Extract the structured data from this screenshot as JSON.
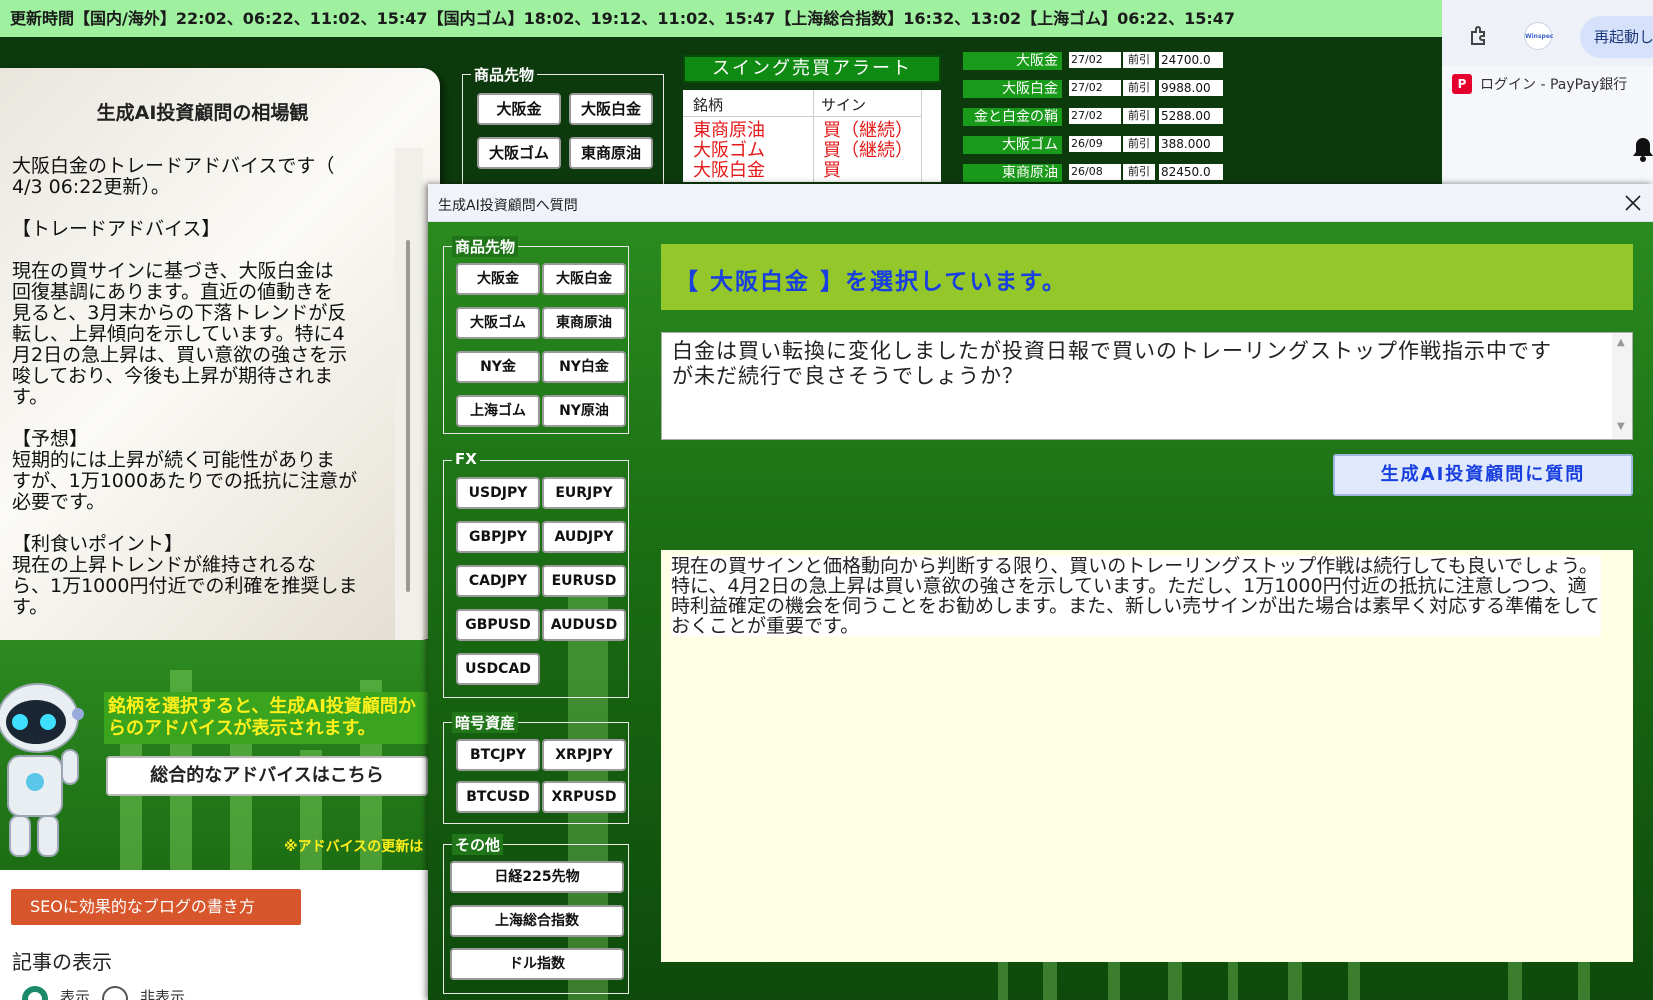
{
  "ticker": "更新時間【国内/海外】22:02、06:22、11:02、15:47【国内ゴム】18:02、19:12、11:02、15:47【上海総合指数】16:32、13:02【上海ゴム】06:22、15:47",
  "browser": {
    "restart_label": "再起動して",
    "ws_badge": "Winspec",
    "bookmark_label": "ログイン - PayPay銀行",
    "bookmark_icon_text": "P"
  },
  "advice": {
    "title": "生成AI投資顧問の相場観",
    "body": "大阪白金のトレードアドバイスです（\n4/3 06:22更新）。\n\n【トレードアドバイス】\n\n現在の買サインに基づき、大阪白金は\n回復基調にあります。直近の値動きを\n見ると、3月末からの下落トレンドが反\n転し、上昇傾向を示しています。特に4\n月2日の急上昇は、買い意欲の強さを示\n唆しており、今後も上昇が期待されま\nす。\n\n【予想】\n短期的には上昇が続く可能性がありま\nすが、1万1000あたりでの抵抗に注意が\n必要です。\n\n【利食いポイント】\n現在の上昇トレンドが維持されるな\nら、1万1000円付近での利確を推奨しま\nす。"
  },
  "left_promo": {
    "note_line1": "銘柄を選択すると、生成AI投資顧問か",
    "note_line2": "らのアドバイスが表示されます。",
    "overall_button": "総合的なアドバイスはこちら",
    "update_note": "※アドバイスの更新は"
  },
  "blog": {
    "seo_button": "SEOに効果的なブログの書き方",
    "article_label": "記事の表示",
    "radio_show": "表示",
    "radio_hide": "非表示"
  },
  "bg_products": {
    "legend": "商品先物",
    "buttons": [
      "大阪金",
      "大阪白金",
      "大阪ゴム",
      "東商原油"
    ]
  },
  "swing": {
    "title": "スイング売買アラート",
    "col_name": "銘柄",
    "col_sign": "サイン",
    "rows": [
      {
        "name": "東商原油",
        "sign": "買（継続）"
      },
      {
        "name": "大阪ゴム",
        "sign": "買（継続）"
      },
      {
        "name": "大阪白金",
        "sign": "買"
      }
    ]
  },
  "prices": [
    {
      "name": "大阪金",
      "date": "27/02",
      "type": "前引",
      "value": "24700.0"
    },
    {
      "name": "大阪白金",
      "date": "27/02",
      "type": "前引",
      "value": "9988.00"
    },
    {
      "name": "金と白金の鞘",
      "date": "27/02",
      "type": "前引",
      "value": "5288.00"
    },
    {
      "name": "大阪ゴム",
      "date": "26/09",
      "type": "前引",
      "value": "388.000"
    },
    {
      "name": "東商原油",
      "date": "26/08",
      "type": "前引",
      "value": "82450.0"
    }
  ],
  "dialog": {
    "title": "生成AI投資顧問へ質問",
    "products_legend": "商品先物",
    "products": [
      "大阪金",
      "大阪白金",
      "大阪ゴム",
      "東商原油",
      "NY金",
      "NY白金",
      "上海ゴム",
      "NY原油"
    ],
    "fx_legend": "FX",
    "fx": [
      "USDJPY",
      "EURJPY",
      "GBPJPY",
      "AUDJPY",
      "CADJPY",
      "EURUSD",
      "GBPUSD",
      "AUDUSD",
      "USDCAD"
    ],
    "crypto_legend": "暗号資産",
    "crypto": [
      "BTCJPY",
      "XRPJPY",
      "BTCUSD",
      "XRPUSD"
    ],
    "other_legend": "その他",
    "other": [
      "日経225先物",
      "上海総合指数",
      "ドル指数"
    ],
    "selected_text": "【 大阪白金 】を選択しています。",
    "question": "白金は買い転換に変化しましたが投資日報で買いのトレーリングストップ作戦指示中ですが未だ続行で良さそうでしょうか？",
    "ask_button": "生成AI投資顧問に質問",
    "answer": "現在の買サインと価格動向から判断する限り、買いのトレーリングストップ作戦は続行しても良いでしょう。特に、4月2日の急上昇は買い意欲の強さを示しています。ただし、1万1000円付近の抵抗に注意しつつ、適時利益確定の機会を伺うことをお勧めします。また、新しい売サインが出た場合は素早く対応する準備をしておくことが重要です。"
  },
  "colors": {
    "ticker_bg": "#9ff09f",
    "selected_bar": "#94c82a",
    "accent_blue": "#1a3fe0",
    "alert_red": "#e41a1a",
    "answer_bg": "#ffffe6"
  }
}
